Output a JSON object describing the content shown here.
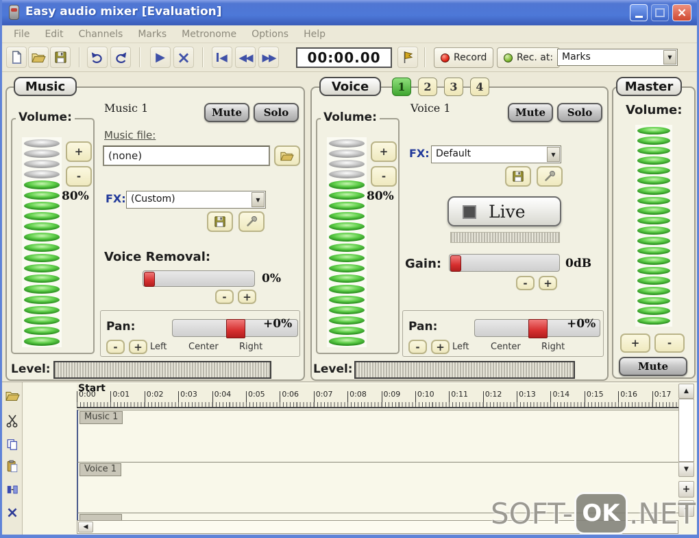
{
  "window": {
    "title": "Easy audio mixer [Evaluation]"
  },
  "menu": {
    "items": [
      "File",
      "Edit",
      "Channels",
      "Marks",
      "Metronome",
      "Options",
      "Help"
    ]
  },
  "toolbar": {
    "time": "00:00.00",
    "record": "Record",
    "rec_at": "Rec. at:",
    "marks": "Marks"
  },
  "icons": {
    "play": "▶",
    "stop": "×",
    "skip_back": "◀",
    "rewind": "◀◀",
    "forward": "▶▶",
    "dropdown_arrow": "▼",
    "scroll_up": "▲",
    "scroll_down": "▼",
    "scroll_left": "◀",
    "plus": "+",
    "minus": "-",
    "close": "×",
    "delete": "×"
  },
  "music": {
    "tab": "Music",
    "name": "Music 1",
    "mute": "Mute",
    "solo": "Solo",
    "volume_label": "Volume:",
    "volume": "80%",
    "meter": {
      "total": 20,
      "on": 16
    },
    "file_label": "Music file:",
    "file_value": "(none)",
    "fx_label": "FX:",
    "fx_value": "(Custom)",
    "voice_removal_label": "Voice Removal:",
    "voice_removal_value": "0%",
    "pan_label": "Pan:",
    "pan_value": "+0%",
    "pan_left": "Left",
    "pan_center": "Center",
    "pan_right": "Right",
    "level_label": "Level:"
  },
  "voice": {
    "tab": "Voice",
    "tabs": [
      "1",
      "2",
      "3",
      "4"
    ],
    "active_tab": "1",
    "name": "Voice 1",
    "mute": "Mute",
    "solo": "Solo",
    "volume_label": "Volume:",
    "volume": "80%",
    "meter": {
      "total": 20,
      "on": 16
    },
    "fx_label": "FX:",
    "fx_value": "Default",
    "live_label": "Live",
    "gain_label": "Gain:",
    "gain_value": "0dB",
    "pan_label": "Pan:",
    "pan_value": "+0%",
    "pan_left": "Left",
    "pan_center": "Center",
    "pan_right": "Right",
    "level_label": "Level:"
  },
  "master": {
    "tab": "Master",
    "volume_label": "Volume:",
    "meter": {
      "total": 20,
      "on": 20
    },
    "plus": "+",
    "minus": "-",
    "mute": "Mute"
  },
  "timeline": {
    "start_label": "Start",
    "ticks": [
      "0:00",
      "0:01",
      "0:02",
      "0:03",
      "0:04",
      "0:05",
      "0:06",
      "0:07",
      "0:08",
      "0:09",
      "0:10",
      "0:11",
      "0:12",
      "0:13",
      "0:14",
      "0:15",
      "0:16",
      "0:17"
    ],
    "tracks": [
      "Music 1",
      "Voice 1"
    ]
  },
  "watermark": {
    "left": "SOFT-",
    "badge": "OK",
    "right": ".NET"
  },
  "colors": {
    "titlebar_blue": "#4d78d8",
    "led_green": "#55c242",
    "led_off": "#c2c2c2",
    "thumb_red": "#d62f2f",
    "active_tab_green": "#56bf45",
    "button_cream": "#f7f3d2",
    "background_beige": "#ece9d8"
  }
}
